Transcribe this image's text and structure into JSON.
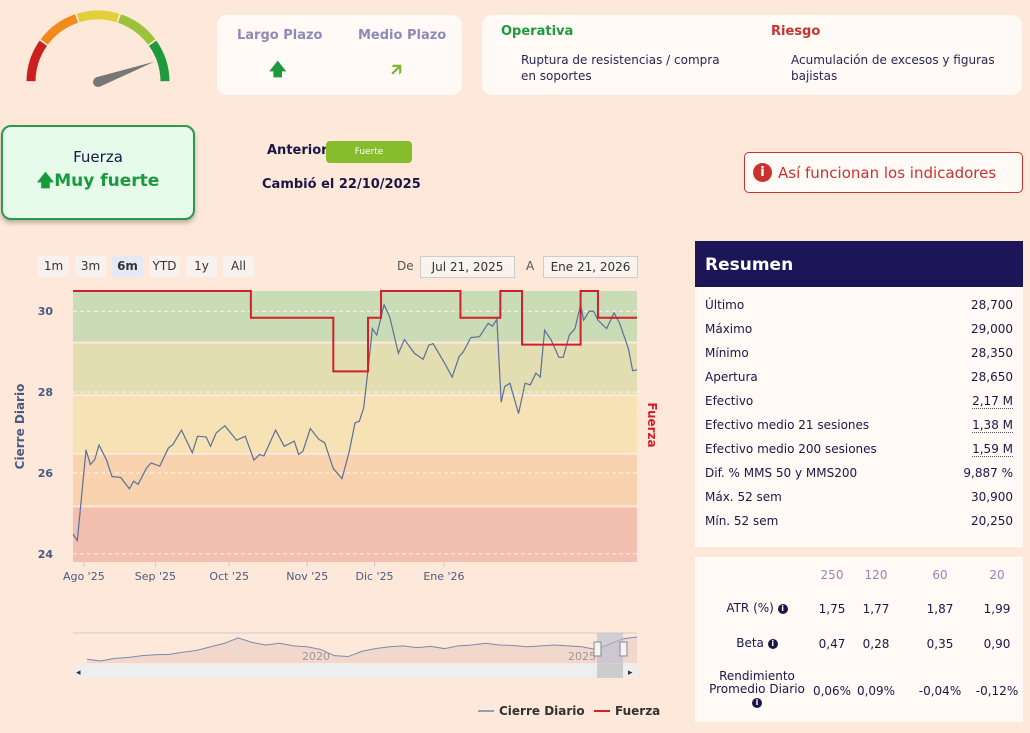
{
  "gauge": {
    "value_fraction": 0.89,
    "colors": [
      "#cc2020",
      "#f08a1a",
      "#e2cf3a",
      "#9cc23a",
      "#1e9a3c"
    ]
  },
  "trends": {
    "long": {
      "label": "Largo Plazo",
      "icon": "arrow-up-icon",
      "glyph": "🡅",
      "color": "#1e9a3c"
    },
    "medium": {
      "label": "Medio Plazo",
      "icon": "arrow-up-right-icon",
      "glyph": "🡭",
      "color": "#7ab52c"
    }
  },
  "operativa": {
    "title": "Operativa",
    "text": "Ruptura de resistencias / compra en soportes",
    "color": "#1e9a3c"
  },
  "riesgo": {
    "title": "Riesgo",
    "text": "Acumulación de excesos y figuras bajistas",
    "color": "#c8332f"
  },
  "fuerza": {
    "title": "Fuerza",
    "value": "Muy fuerte",
    "arrow": "🡅"
  },
  "anterior": {
    "label": "Anterior",
    "value": "Fuerte"
  },
  "cambio": "Cambió el 22/10/2025",
  "info_button": {
    "icon": "i",
    "label": "Así funcionan los indicadores"
  },
  "range_buttons": [
    "1m",
    "3m",
    "6m",
    "YTD",
    "1y",
    "All"
  ],
  "range_selected": "6m",
  "date_range": {
    "from_label": "De",
    "from": "Jul 21, 2025",
    "to_label": "A",
    "to": "Ene 21, 2026"
  },
  "chart_data": {
    "type": "line",
    "ylabel": "Cierre Diario",
    "y2label": "Fuerza",
    "ylim": [
      23.8,
      30.5
    ],
    "yticks": [
      24,
      26,
      28,
      30
    ],
    "xticks": [
      {
        "label": "Ago '25",
        "x": 2.5
      },
      {
        "label": "Sep '25",
        "x": 19
      },
      {
        "label": "Oct '25",
        "x": 36
      },
      {
        "label": "Nov '25",
        "x": 54
      },
      {
        "label": "Dic '25",
        "x": 69.5
      },
      {
        "label": "Ene '26",
        "x": 85.5
      }
    ],
    "xlim": [
      0,
      130
    ],
    "bands": [
      {
        "from": 23.8,
        "to": 25.15,
        "color": "#f2bfb0"
      },
      {
        "from": 25.2,
        "to": 26.45,
        "color": "#f9d3ae"
      },
      {
        "from": 26.5,
        "to": 27.9,
        "color": "#f6e2b5"
      },
      {
        "from": 27.95,
        "to": 29.2,
        "color": "#e2deb1"
      },
      {
        "from": 29.25,
        "to": 30.5,
        "color": "#cadcb6"
      }
    ],
    "series": [
      {
        "name": "Cierre Diario",
        "color": "#5a6f9a",
        "points": [
          [
            0,
            24.49
          ],
          [
            1,
            24.33
          ],
          [
            3,
            26.57
          ],
          [
            4,
            26.21
          ],
          [
            5,
            26.33
          ],
          [
            6,
            26.69
          ],
          [
            7.7,
            26.33
          ],
          [
            9,
            25.91
          ],
          [
            11,
            25.89
          ],
          [
            13,
            25.61
          ],
          [
            14,
            25.8
          ],
          [
            15,
            25.72
          ],
          [
            17,
            26.13
          ],
          [
            18,
            26.25
          ],
          [
            20,
            26.17
          ],
          [
            22,
            26.62
          ],
          [
            23,
            26.7
          ],
          [
            25,
            27.06
          ],
          [
            27.5,
            26.5
          ],
          [
            28.7,
            26.91
          ],
          [
            30.7,
            26.89
          ],
          [
            31.7,
            26.66
          ],
          [
            33,
            26.99
          ],
          [
            35,
            27.17
          ],
          [
            37.7,
            26.81
          ],
          [
            39.7,
            26.91
          ],
          [
            41.7,
            26.32
          ],
          [
            43,
            26.46
          ],
          [
            44,
            26.42
          ],
          [
            46.7,
            27.06
          ],
          [
            48.7,
            26.66
          ],
          [
            51,
            26.79
          ],
          [
            52,
            26.46
          ],
          [
            53,
            26.54
          ],
          [
            54.7,
            27.1
          ],
          [
            56.7,
            26.83
          ],
          [
            58,
            26.75
          ],
          [
            60,
            26.11
          ],
          [
            62,
            25.86
          ],
          [
            63.7,
            26.54
          ],
          [
            65,
            27.24
          ],
          [
            66,
            27.28
          ],
          [
            67,
            27.61
          ],
          [
            68,
            28.55
          ],
          [
            69,
            29.57
          ],
          [
            70,
            29.41
          ],
          [
            71.7,
            30.16
          ],
          [
            73,
            29.86
          ],
          [
            75,
            28.96
          ],
          [
            76.4,
            29.3
          ],
          [
            78.7,
            28.96
          ],
          [
            80.7,
            28.81
          ],
          [
            82,
            29.16
          ],
          [
            83,
            29.2
          ],
          [
            85.7,
            28.71
          ],
          [
            87.4,
            28.37
          ],
          [
            89,
            28.88
          ],
          [
            90,
            29.0
          ],
          [
            91.7,
            29.35
          ],
          [
            93.7,
            29.37
          ],
          [
            95.7,
            29.7
          ],
          [
            96.7,
            29.63
          ],
          [
            97.7,
            29.8
          ],
          [
            98.7,
            27.75
          ],
          [
            99.5,
            28.14
          ],
          [
            100.7,
            28.22
          ],
          [
            102.7,
            27.47
          ],
          [
            104.2,
            28.22
          ],
          [
            105.4,
            28.18
          ],
          [
            106.7,
            28.47
          ],
          [
            107.7,
            28.37
          ],
          [
            108.7,
            29.53
          ],
          [
            110.2,
            29.29
          ],
          [
            112,
            28.86
          ],
          [
            113,
            28.86
          ],
          [
            114.4,
            29.41
          ],
          [
            115.7,
            29.57
          ],
          [
            117,
            30.16
          ],
          [
            117.7,
            29.78
          ],
          [
            119,
            30.0
          ],
          [
            120,
            30.0
          ],
          [
            121,
            29.78
          ],
          [
            123,
            29.57
          ],
          [
            124.7,
            29.96
          ],
          [
            126,
            29.7
          ],
          [
            128,
            29.08
          ],
          [
            129,
            28.53
          ],
          [
            130,
            28.55
          ]
        ]
      },
      {
        "name": "Fuerza",
        "color": "#d0202a",
        "step": true,
        "ylim_levels": [
          1,
          5
        ],
        "points": [
          [
            0,
            5
          ],
          [
            41,
            4
          ],
          [
            60,
            2
          ],
          [
            68,
            4
          ],
          [
            71,
            5
          ],
          [
            89.3,
            4
          ],
          [
            98.5,
            5
          ],
          [
            103.5,
            3
          ],
          [
            117,
            5
          ],
          [
            121,
            4
          ],
          [
            130,
            4
          ]
        ]
      }
    ],
    "navigator": {
      "labels": [
        "2020",
        "2025"
      ],
      "values": [
        24,
        23.6,
        24.2,
        24.4,
        24.8,
        25,
        25.1,
        25.6,
        26,
        26.8,
        27.6,
        28.8,
        27.8,
        27.2,
        27.6,
        27,
        26.8,
        26.2,
        24.8,
        24.6,
        25.8,
        26.4,
        26.8,
        27,
        26.6,
        26.9,
        26.4,
        27,
        27.2,
        27.6,
        27.2,
        27.1,
        26.8,
        27,
        27.2,
        27,
        26.8,
        26.2,
        27.4,
        28.6,
        29
      ]
    }
  },
  "resumen": {
    "title": "Resumen",
    "rows": [
      {
        "label": "Último",
        "value": "28,700"
      },
      {
        "label": "Máximo",
        "value": "29,000"
      },
      {
        "label": "Mínimo",
        "value": "28,350"
      },
      {
        "label": "Apertura",
        "value": "28,650"
      },
      {
        "label": "Efectivo",
        "value": "2,17 M",
        "u": true
      },
      {
        "label": "Efectivo medio 21 sesiones",
        "value": "1,38 M",
        "u": true
      },
      {
        "label": "Efectivo medio 200 sesiones",
        "value": "1,59 M",
        "u": true
      },
      {
        "label": "Dif. % MMS 50 y MMS200",
        "value": "9,887 %"
      },
      {
        "label": "Máx. 52 sem",
        "value": "30,900"
      },
      {
        "label": "Mín. 52 sem",
        "value": "20,250"
      }
    ]
  },
  "stats": {
    "headers": [
      "250",
      "120",
      "60",
      "20"
    ],
    "rows": [
      {
        "label": "ATR (%)",
        "values": [
          "1,75",
          "1,77",
          "1,87",
          "1,99"
        ]
      },
      {
        "label": "Beta",
        "values": [
          "0,47",
          "0,28",
          "0,35",
          "0,90"
        ]
      },
      {
        "label": "Rendimiento Promedio Diario",
        "values": [
          "0,06%",
          "0,09%",
          "-0,04%",
          "-0,12%"
        ]
      }
    ]
  },
  "legend": [
    "Cierre Diario",
    "Fuerza"
  ]
}
